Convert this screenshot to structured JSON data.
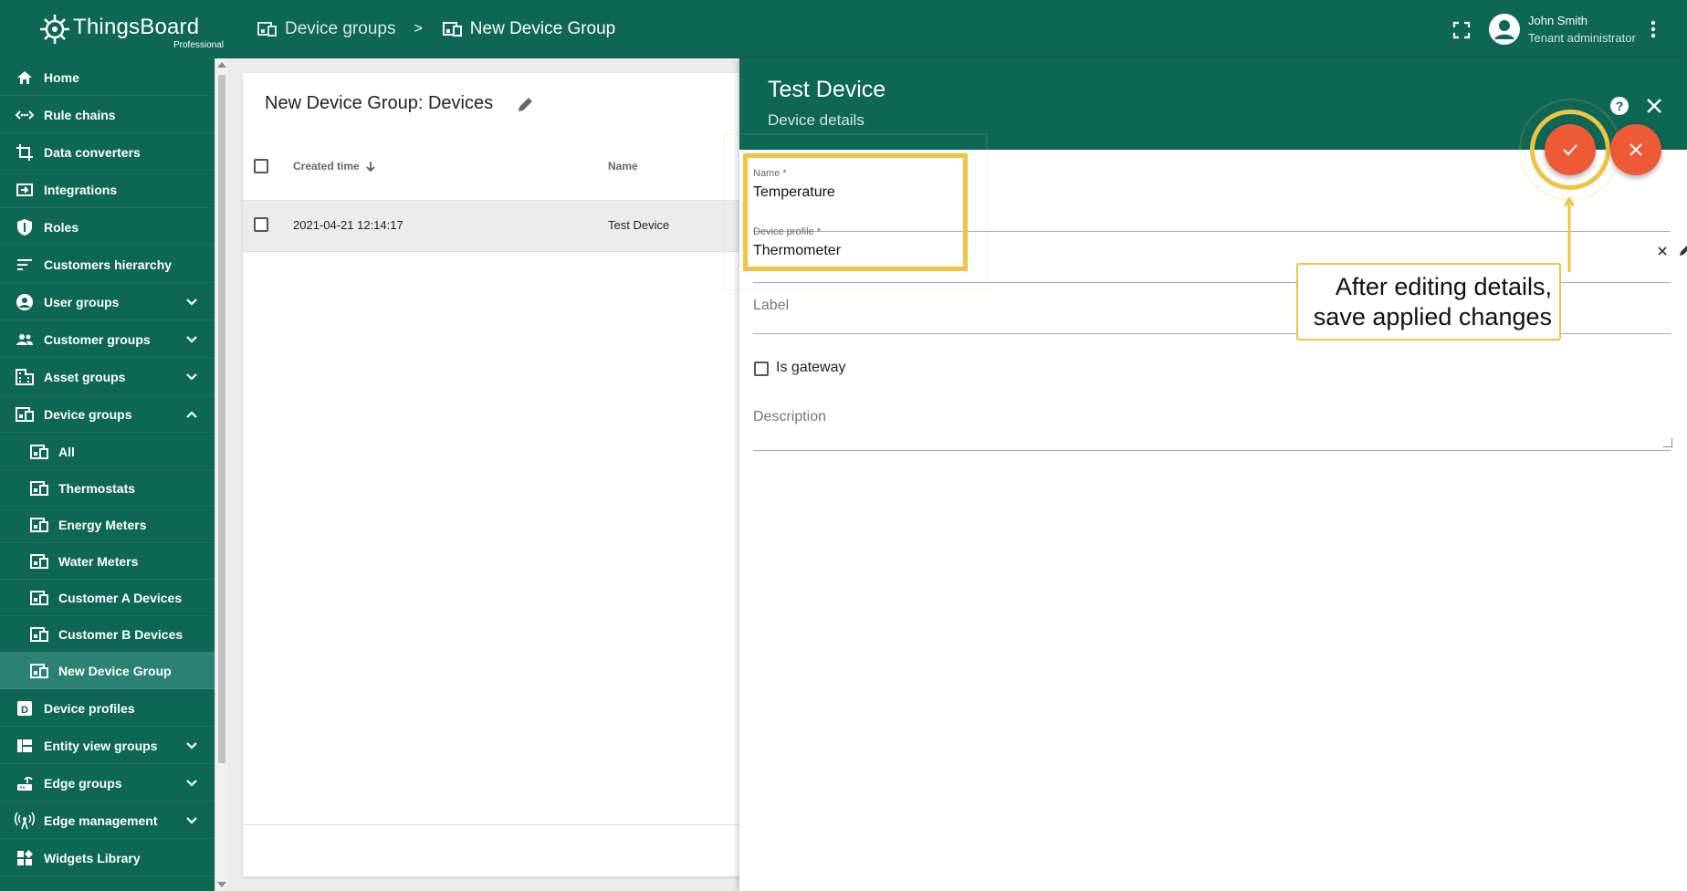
{
  "brand": {
    "title": "ThingsBoard",
    "subtitle": "Professional"
  },
  "breadcrumb": {
    "parent": "Device groups",
    "separator": ">",
    "current": "New Device Group"
  },
  "user": {
    "name": "John Smith",
    "role": "Tenant administrator"
  },
  "sidebar": {
    "items": [
      {
        "label": "Home",
        "icon": "home-icon"
      },
      {
        "label": "Rule chains",
        "icon": "rule-chain-icon"
      },
      {
        "label": "Data converters",
        "icon": "converter-icon"
      },
      {
        "label": "Integrations",
        "icon": "integration-icon"
      },
      {
        "label": "Roles",
        "icon": "shield-icon"
      },
      {
        "label": "Customers hierarchy",
        "icon": "hierarchy-icon"
      },
      {
        "label": "User groups",
        "icon": "account-icon"
      },
      {
        "label": "Customer groups",
        "icon": "people-icon"
      },
      {
        "label": "Asset groups",
        "icon": "building-icon"
      },
      {
        "label": "Device groups",
        "icon": "devices-icon"
      },
      {
        "label": "All",
        "icon": "devices-icon"
      },
      {
        "label": "Thermostats",
        "icon": "devices-icon"
      },
      {
        "label": "Energy Meters",
        "icon": "devices-icon"
      },
      {
        "label": "Water Meters",
        "icon": "devices-icon"
      },
      {
        "label": "Customer A Devices",
        "icon": "devices-icon"
      },
      {
        "label": "Customer B Devices",
        "icon": "devices-icon"
      },
      {
        "label": "New Device Group",
        "icon": "devices-icon"
      },
      {
        "label": "Device profiles",
        "icon": "device-profile-icon"
      },
      {
        "label": "Entity view groups",
        "icon": "view-icon"
      },
      {
        "label": "Edge groups",
        "icon": "router-icon"
      },
      {
        "label": "Edge management",
        "icon": "antenna-icon"
      },
      {
        "label": "Widgets Library",
        "icon": "widgets-icon"
      }
    ]
  },
  "table": {
    "title": "New Device Group: Devices",
    "columns": [
      "Created time",
      "Name"
    ],
    "rows": [
      {
        "created": "2021-04-21 12:14:17",
        "name": "Test Device"
      }
    ]
  },
  "details": {
    "title": "Test Device",
    "subtitle": "Device details",
    "name_label": "Name *",
    "name_value": "Temperature",
    "profile_label": "Device profile *",
    "profile_value": "Thermometer",
    "label_placeholder": "Label",
    "gateway_label": "Is gateway",
    "description_placeholder": "Description"
  },
  "callout": {
    "line1": "After editing details,",
    "line2": "save applied changes"
  },
  "colors": {
    "primary": "#0e6655",
    "accent": "#ee5a35",
    "highlight": "#f0c342"
  }
}
